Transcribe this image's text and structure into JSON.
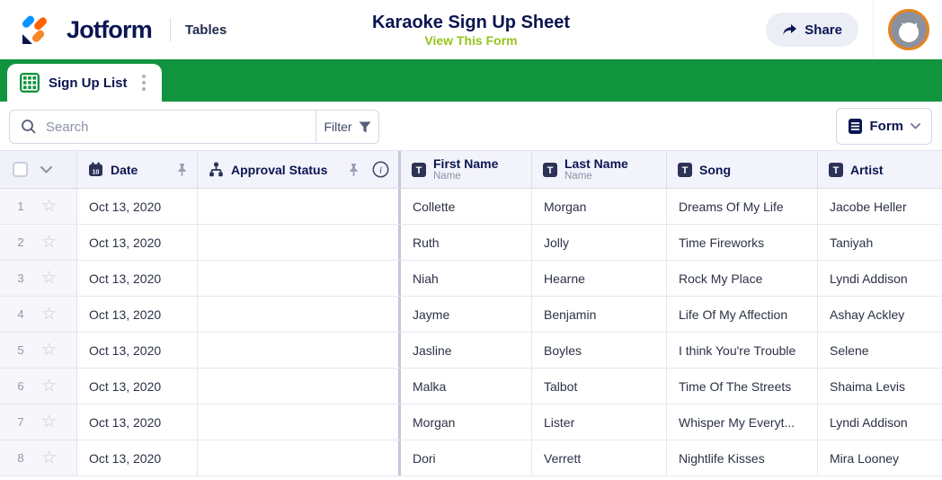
{
  "header": {
    "brand": "Jotform",
    "product": "Tables",
    "title": "Karaoke Sign Up Sheet",
    "view_link": "View This Form",
    "share_label": "Share"
  },
  "tab_bar": {
    "active_tab": "Sign Up List"
  },
  "toolbar": {
    "search_placeholder": "Search",
    "filter_label": "Filter",
    "form_label": "Form"
  },
  "icons": {
    "calendar_day": "10",
    "text_icon_glyph": "T",
    "info_glyph": "i",
    "star_glyph": "☆"
  },
  "colors": {
    "accent_green": "#11943e",
    "lime_link": "#96c41c",
    "navy": "#0a1551",
    "avatar_ring": "#e8831c",
    "header_bg": "#f3f3fb"
  },
  "table": {
    "columns": [
      {
        "id": "date",
        "label": "Date",
        "icon": "calendar-icon",
        "pinned": true
      },
      {
        "id": "approval",
        "label": "Approval Status",
        "icon": "approval-flow-icon",
        "pinned": true,
        "info": true
      },
      {
        "id": "first_name",
        "label": "First Name",
        "sublabel": "Name",
        "icon": "text-icon"
      },
      {
        "id": "last_name",
        "label": "Last Name",
        "sublabel": "Name",
        "icon": "text-icon"
      },
      {
        "id": "song",
        "label": "Song",
        "icon": "text-icon"
      },
      {
        "id": "artist",
        "label": "Artist",
        "icon": "text-icon"
      }
    ],
    "rows": [
      {
        "num": "1",
        "date": "Oct 13, 2020",
        "approval": "",
        "first_name": "Collette",
        "last_name": "Morgan",
        "song": "Dreams Of My Life",
        "artist": "Jacobe Heller"
      },
      {
        "num": "2",
        "date": "Oct 13, 2020",
        "approval": "",
        "first_name": "Ruth",
        "last_name": "Jolly",
        "song": "Time Fireworks",
        "artist": "Taniyah"
      },
      {
        "num": "3",
        "date": "Oct 13, 2020",
        "approval": "",
        "first_name": "Niah",
        "last_name": "Hearne",
        "song": "Rock My Place",
        "artist": "Lyndi Addison"
      },
      {
        "num": "4",
        "date": "Oct 13, 2020",
        "approval": "",
        "first_name": "Jayme",
        "last_name": "Benjamin",
        "song": "Life Of My Affection",
        "artist": "Ashay Ackley"
      },
      {
        "num": "5",
        "date": "Oct 13, 2020",
        "approval": "",
        "first_name": "Jasline",
        "last_name": "Boyles",
        "song": "I think You're Trouble",
        "artist": "Selene"
      },
      {
        "num": "6",
        "date": "Oct 13, 2020",
        "approval": "",
        "first_name": "Malka",
        "last_name": "Talbot",
        "song": "Time Of The Streets",
        "artist": "Shaima Levis"
      },
      {
        "num": "7",
        "date": "Oct 13, 2020",
        "approval": "",
        "first_name": "Morgan",
        "last_name": "Lister",
        "song": "Whisper My Everyt...",
        "artist": "Lyndi Addison"
      },
      {
        "num": "8",
        "date": "Oct 13, 2020",
        "approval": "",
        "first_name": "Dori",
        "last_name": "Verrett",
        "song": "Nightlife Kisses",
        "artist": "Mira Looney"
      }
    ]
  }
}
